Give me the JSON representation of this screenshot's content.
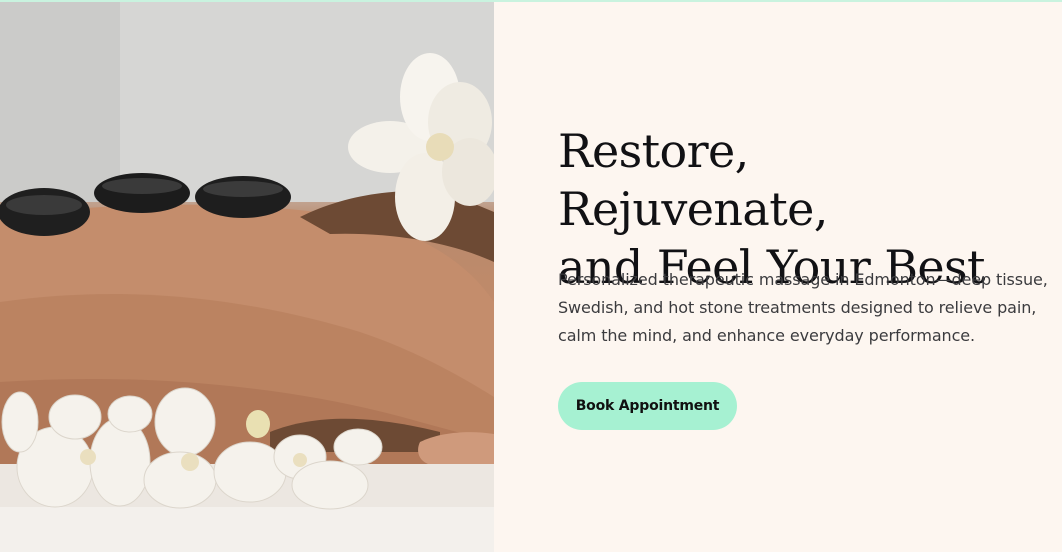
{
  "hero": {
    "headline_line1": "Restore, Rejuvenate,",
    "headline_line2": "and Feel Your Best",
    "subtext": "Personalized therapeutic massage in Edmonton—deep tissue, Swedish, and hot stone treatments designed to relieve pain, calm the mind, and enhance everyday performance.",
    "cta_label": "Book Appointment"
  },
  "colors": {
    "accent": "#a6f1d2",
    "background": "#fdf6f0",
    "headline": "#111114",
    "body_text": "#3b3b3e"
  }
}
